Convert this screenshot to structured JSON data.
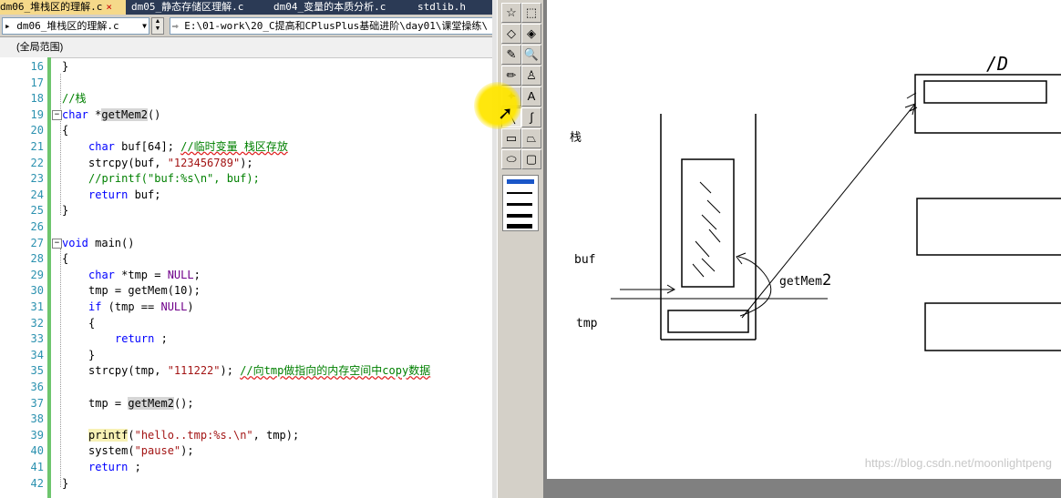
{
  "tabs": [
    {
      "label": "dm06_堆栈区的理解.c",
      "close": "×",
      "active": true
    },
    {
      "label": "dm05_静态存储区理解.c",
      "active": false
    },
    {
      "label": "dm04_变量的本质分析.c",
      "active": false
    },
    {
      "label": "stdlib.h",
      "active": false
    }
  ],
  "toolbar": {
    "file_combo": "dm06_堆栈区的理解.c",
    "path_combo": "E:\\01-work\\20_C提高和CPlusPlus基础进阶\\day01\\课堂操练\\"
  },
  "scope": "(全局范围)",
  "code_lines": [
    {
      "n": "16",
      "text": "}"
    },
    {
      "n": "17",
      "text": ""
    },
    {
      "n": "18",
      "text": "//栈"
    },
    {
      "n": "19",
      "text": "char *getMem2()"
    },
    {
      "n": "20",
      "text": "{"
    },
    {
      "n": "21",
      "text": "char buf[64]; //临时变量 栈区存放"
    },
    {
      "n": "22",
      "text": "strcpy(buf, \"123456789\");"
    },
    {
      "n": "23",
      "text": "//printf(\"buf:%s\\n\", buf);"
    },
    {
      "n": "24",
      "text": "return buf;"
    },
    {
      "n": "25",
      "text": "}"
    },
    {
      "n": "26",
      "text": ""
    },
    {
      "n": "27",
      "text": "void main()"
    },
    {
      "n": "28",
      "text": "{"
    },
    {
      "n": "29",
      "text": "char *tmp = NULL;"
    },
    {
      "n": "30",
      "text": "tmp = getMem(10);"
    },
    {
      "n": "31",
      "text": "if (tmp == NULL)"
    },
    {
      "n": "32",
      "text": "{"
    },
    {
      "n": "33",
      "text": "return ;"
    },
    {
      "n": "34",
      "text": "}"
    },
    {
      "n": "35",
      "text": "strcpy(tmp, \"111222\"); //向tmp做指向的内存空间中copy数据"
    },
    {
      "n": "36",
      "text": ""
    },
    {
      "n": "37",
      "text": "tmp = getMem2();"
    },
    {
      "n": "38",
      "text": ""
    },
    {
      "n": "39",
      "text": "printf(\"hello..tmp:%s.\\n\", tmp);"
    },
    {
      "n": "40",
      "text": "system(\"pause\");"
    },
    {
      "n": "41",
      "text": "return ;"
    },
    {
      "n": "42",
      "text": "}"
    }
  ],
  "palette": {
    "tools": [
      "free-select",
      "rect-select",
      "eraser",
      "fill",
      "color-picker",
      "magnifier",
      "pencil",
      "brush",
      "airbrush",
      "text",
      "line",
      "curve",
      "rectangle",
      "polygon",
      "ellipse",
      "rounded-rectangle"
    ],
    "tool_glyphs": [
      "☆",
      "⬚",
      "◇",
      "◈",
      "✎",
      "🔍",
      "✏",
      "♙",
      "✦",
      "A",
      "╲",
      "∫",
      "▭",
      "⏢",
      "⬭",
      "▢"
    ],
    "active_tool": "line"
  },
  "canvas": {
    "label_stack": "栈",
    "label_buf": "buf",
    "label_tmp": "tmp",
    "label_getmem": "getMem",
    "label_getmem_suffix": "2",
    "label_top": "/D"
  },
  "watermark": "https://blog.csdn.net/moonlightpeng",
  "colors": {
    "keyword": "#0000ff",
    "comment": "#008000",
    "string": "#a31515",
    "macro": "#6f008a",
    "line_number": "#2b91af",
    "active_tab": "#f5d98a"
  }
}
